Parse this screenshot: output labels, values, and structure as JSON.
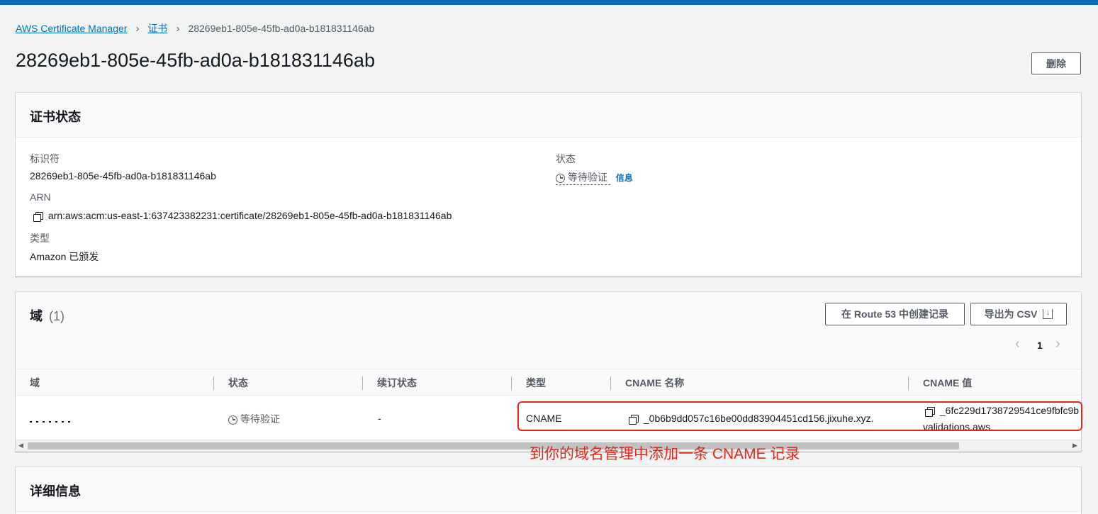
{
  "breadcrumb": {
    "root": "AWS Certificate Manager",
    "parent": "证书",
    "current": "28269eb1-805e-45fb-ad0a-b181831146ab"
  },
  "page": {
    "title": "28269eb1-805e-45fb-ad0a-b181831146ab",
    "delete_label": "删除"
  },
  "cert_status": {
    "title": "证书状态",
    "identifier_label": "标识符",
    "identifier_value": "28269eb1-805e-45fb-ad0a-b181831146ab",
    "arn_label": "ARN",
    "arn_value": "arn:aws:acm:us-east-1:637423382231:certificate/28269eb1-805e-45fb-ad0a-b181831146ab",
    "type_label": "类型",
    "type_value": "Amazon 已颁发",
    "status_label": "状态",
    "status_value": "等待验证",
    "info_link": "信息"
  },
  "domains": {
    "title": "域",
    "count": "(1)",
    "route53_label": "在 Route 53 中创建记录",
    "export_label": "导出为 CSV",
    "page_number": "1",
    "columns": [
      "域",
      "状态",
      "续订状态",
      "类型",
      "CNAME 名称",
      "CNAME 值"
    ],
    "row": {
      "domain": "",
      "status": "等待验证",
      "renewal": "-",
      "type": "CNAME",
      "cname_name": "_0b6b9dd057c16be00dd83904451cd156.jixuhe.xyz.",
      "cname_value_line1": "_6fc229d1738729541ce9fbfc9b",
      "cname_value_line2": "validations.aws."
    }
  },
  "annotation": {
    "text": "到你的域名管理中添加一条 CNAME 记录",
    "color": "#e8251b"
  },
  "details": {
    "title": "详细信息"
  },
  "colors": {
    "accent": "#0073bb",
    "topbar": "#0b6bb8"
  }
}
